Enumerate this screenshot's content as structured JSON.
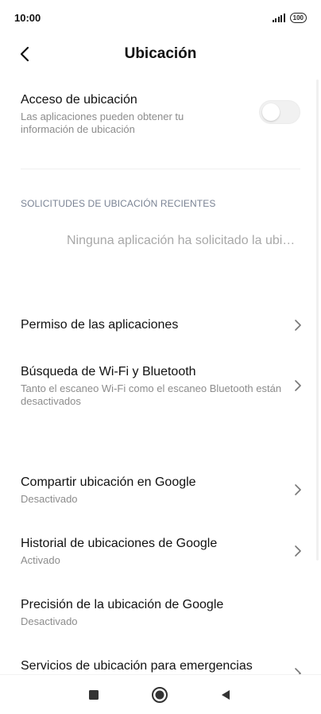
{
  "status_bar": {
    "time": "10:00",
    "battery": "100"
  },
  "header": {
    "title": "Ubicación"
  },
  "location_access": {
    "title": "Acceso de ubicación",
    "subtitle": "Las aplicaciones pueden obtener tu información de ubicación",
    "enabled": false
  },
  "recent_requests": {
    "header": "SOLICITUDES DE UBICACIÓN RECIENTES",
    "empty_text": "Ninguna aplicación ha solicitado la ubicación recientemente"
  },
  "items": [
    {
      "title": "Permiso de las aplicaciones",
      "subtitle": ""
    },
    {
      "title": "Búsqueda de Wi-Fi y Bluetooth",
      "subtitle": "Tanto el escaneo Wi-Fi como el escaneo Bluetooth están desactivados"
    },
    {
      "title": "Compartir ubicación en Google",
      "subtitle": "Desactivado"
    },
    {
      "title": "Historial de ubicaciones de Google",
      "subtitle": "Activado"
    },
    {
      "title": "Precisión de la ubicación de Google",
      "subtitle": "Desactivado"
    },
    {
      "title": "Servicios de ubicación para emergencias",
      "subtitle": ""
    }
  ],
  "colors": {
    "section_header": "#7a8394",
    "subtitle": "#8c8c8c",
    "toggle_off": "#f1f1f1"
  },
  "icons": {
    "back": "back-arrow-icon",
    "chevron": "chevron-right-icon",
    "nav_recents": "square-icon",
    "nav_home": "circle-icon",
    "nav_back": "triangle-back-icon"
  }
}
